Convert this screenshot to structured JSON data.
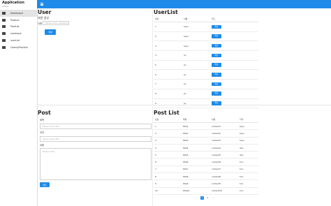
{
  "app": {
    "title": "Application",
    "subtitle": "admin"
  },
  "sidebar": {
    "items": [
      {
        "label": "Dashboard",
        "active": true
      },
      {
        "label": "Product"
      },
      {
        "label": "PostList"
      },
      {
        "label": "userInput"
      },
      {
        "label": "userList"
      },
      {
        "label": "OpenlyPractice"
      }
    ]
  },
  "user": {
    "title": "User",
    "subtitle": "회원 생성",
    "name_label": "이름",
    "name_placeholder": "Please enter userName",
    "submit_label": "생성"
  },
  "userlist": {
    "title": "UserList",
    "headers": [
      "번호",
      "이름",
      "버그"
    ],
    "rows": [
      {
        "no": "1",
        "name": "hyun",
        "action": "제출"
      },
      {
        "no": "2",
        "name": "hyun",
        "action": "제출"
      },
      {
        "no": "3",
        "name": "hyun",
        "action": "제출"
      },
      {
        "no": "4",
        "name": "jin",
        "action": "제출"
      },
      {
        "no": "5",
        "name": "jin",
        "action": "제출"
      },
      {
        "no": "6",
        "name": "jin",
        "action": "제출"
      },
      {
        "no": "7",
        "name": "jin",
        "action": "제출"
      },
      {
        "no": "8",
        "name": "jin",
        "action": "제출"
      },
      {
        "no": "9",
        "name": "jin",
        "action": "제출"
      }
    ]
  },
  "post": {
    "title": "Post",
    "label1": "제목",
    "placeholder1": "Please enter title",
    "label2": "저자",
    "placeholder2": "Please enter title",
    "label3": "내용",
    "placeholder3": "Please enter",
    "submit_label": "제출"
  },
  "postlist": {
    "title": "Post List",
    "headers": [
      "번호",
      "제목",
      "내용",
      "저자"
    ],
    "rows": [
      [
        "1",
        "title1",
        "content1",
        "hyun"
      ],
      [
        "2",
        "title2",
        "content2",
        "hyun"
      ],
      [
        "3",
        "title3",
        "content3",
        "hyun"
      ],
      [
        "4",
        "title4",
        "content4",
        "dan"
      ],
      [
        "5",
        "title5",
        "content5",
        "dan"
      ],
      [
        "6",
        "title6",
        "content6",
        "hnn"
      ],
      [
        "7",
        "title7",
        "content7",
        "hnn"
      ],
      [
        "8",
        "title8",
        "content8",
        "hnn"
      ],
      [
        "9",
        "title9",
        "content9",
        "hnn"
      ],
      [
        "10",
        "title10",
        "content10",
        "hnn"
      ]
    ],
    "pages": [
      "‹",
      "1",
      "2",
      "›"
    ],
    "active_page": "1"
  }
}
